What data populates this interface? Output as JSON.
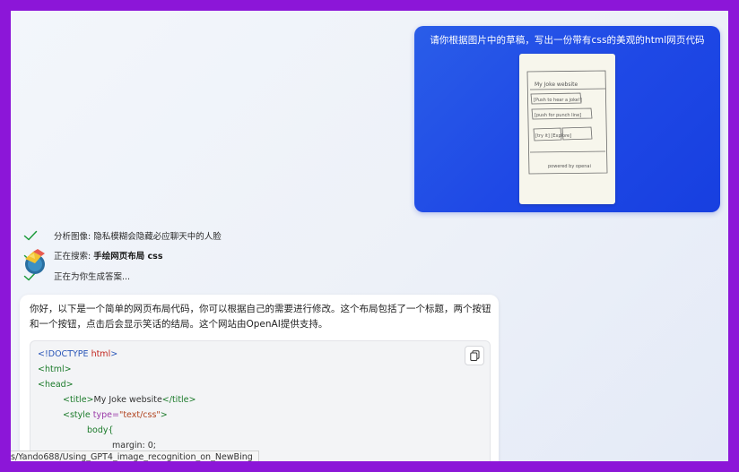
{
  "user_message": {
    "text": "请你根据图片中的草稿，写出一份带有css的美观的html网页代码",
    "sketch": {
      "header": "My Joke website",
      "button1": "[Push to hear a joke!]",
      "button2": "[push for punch line]",
      "row": "[try it] [Explore]",
      "footer": "powered by openai"
    }
  },
  "steps": [
    {
      "prefix": "分析图像: ",
      "text": "隐私模糊会隐藏必应聊天中的人脸",
      "bold": ""
    },
    {
      "prefix": "正在搜索: ",
      "text": "",
      "bold": "手绘网页布局 css"
    },
    {
      "prefix": "正在为你生成答案...",
      "text": "",
      "bold": ""
    }
  ],
  "reply": {
    "text": "你好，以下是一个简单的网页布局代码，你可以根据自己的需要进行修改。这个布局包括了一个标题，两个按钮和一个按钮，点击后会显示笑话的结局。这个网站由OpenAI提供支持。",
    "code": {
      "doctype_open": "<!DOCTYPE ",
      "doctype_kw": "html",
      "doctype_close": ">",
      "html_tag": "<html>",
      "head_tag": "<head>",
      "title_open": "<title>",
      "title_text": "My Joke website",
      "title_close": "</title>",
      "style_open": "<style ",
      "style_attr": "type=",
      "style_val": "\"text/css\"",
      "style_close": ">",
      "body_sel": "body{",
      "margin_line": "margin: 0;"
    }
  },
  "status_url": "s/Yando688/Using_GPT4_image_recognition_on_NewBing",
  "colors": {
    "frame": "#8c16d8",
    "user_bubble": "#1f49e6",
    "check": "#1b9a3a"
  },
  "icons": [
    "check-icon",
    "copy-icon",
    "bing-avatar-icon"
  ]
}
